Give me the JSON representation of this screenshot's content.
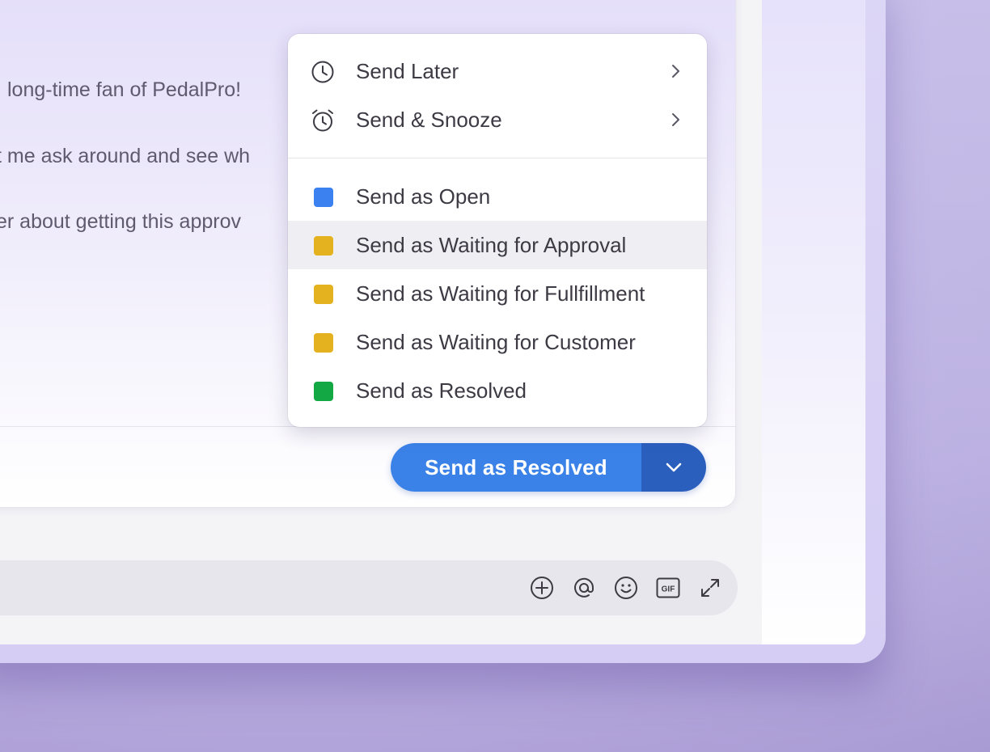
{
  "message": {
    "lines": [
      "long-time fan of PedalPro! ",
      "t me ask around and see wh",
      "er about getting this approv"
    ]
  },
  "send_button": {
    "label": "Send as Resolved",
    "toggle_icon": "chevron-down-icon"
  },
  "menu": {
    "schedule_items": [
      {
        "label": "Send Later",
        "icon": "clock-icon"
      },
      {
        "label": "Send & Snooze",
        "icon": "alarm-clock-icon"
      }
    ],
    "status_items": [
      {
        "label": "Send as Open",
        "color": "#3b82f0"
      },
      {
        "label": "Send as Waiting for Approval",
        "color": "#e3b21e",
        "highlighted": true
      },
      {
        "label": "Send as Waiting for Fullfillment",
        "color": "#e3b21e"
      },
      {
        "label": "Send as Waiting for Customer",
        "color": "#e3b21e"
      },
      {
        "label": "Send as Resolved",
        "color": "#14a845"
      }
    ]
  },
  "reply_toolbar": {
    "icons": [
      "add-circle-icon",
      "mention-icon",
      "emoji-icon",
      "gif-icon",
      "expand-icon"
    ],
    "gif_text": "GIF"
  },
  "colors": {
    "accent": "#3b82e8",
    "accent_dark": "#2b5fbe",
    "background": "#b9aedf"
  }
}
